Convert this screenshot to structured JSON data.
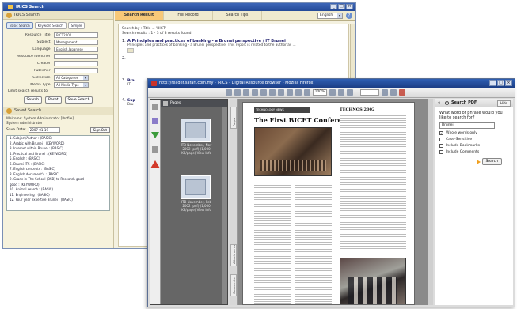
{
  "search_window": {
    "title": "IRICS Search",
    "window_controls": [
      "_",
      "□",
      "×"
    ],
    "basic_panel": {
      "heading": "IRICS Search",
      "modes": [
        "Basic Search",
        "Keyword Search",
        "Simple"
      ],
      "fields": [
        {
          "label": "Resource Title:",
          "value": "BICT2002",
          "kind": "input"
        },
        {
          "label": "Subject:",
          "value": "Management",
          "kind": "input"
        },
        {
          "label": "Language:",
          "value": "English,Japanese",
          "kind": "input"
        },
        {
          "label": "Resource Identifier:",
          "value": "",
          "kind": "input"
        },
        {
          "label": "Creator:",
          "value": "",
          "kind": "input"
        },
        {
          "label": "Publisher:",
          "value": "",
          "kind": "input"
        },
        {
          "label": "Collection:",
          "value": "All Categories",
          "kind": "select"
        },
        {
          "label": "Media Type:",
          "value": "All Media Type",
          "kind": "select"
        }
      ],
      "limit_label": "Limit search results to:",
      "actions": [
        "Search",
        "Reset",
        "Save Search"
      ]
    },
    "saved_panel": {
      "heading": "Saved Search",
      "info_lines": [
        "Welcome: System Administrator [Profile]",
        "System Administrator"
      ],
      "date_label": "Save Date:",
      "date_value": "2007-01-19",
      "sign_out": "Sign Out",
      "items": [
        "1. Subject/Author : (BASIC)",
        "2. Arabic with Brunei : (KEYWORD)",
        "3. Internet within Brunei : (BASIC)",
        "4. Practical and Brunei : (KEYWORD)",
        "5. English : (BASIC)",
        "6. Brunei ITS : (BASIC)",
        "7. English concepts : (BASIC)",
        "8. English document's : (BASIC)",
        "9. Grade in The School (BSB) to Research good",
        "   good : (KEYWORD)",
        "10. Animal search : (BASIC)",
        "11. Engineering : (BASIC)",
        "12. Four year expertise Brunei : (BASIC)"
      ]
    },
    "tabs": [
      "Search Result",
      "Full Record",
      "Search Tips"
    ],
    "active_tab": "Search Result",
    "language": "English",
    "results_header": "Search by : Title = 'BICT'",
    "results_count": "Search results : 1 - 3 of 3 results found",
    "results": [
      {
        "num": "1.",
        "title": "A Principles and practices of banking - a Brunei perspective / IT Brunei",
        "sub": "Principles and practices of banking - a Brunei perspective. This report is related to the author as ..."
      },
      {
        "num": "2.",
        "title": "",
        "sub": ""
      },
      {
        "num": "3.",
        "title": "Bra",
        "sub": "IT"
      },
      {
        "num": "4.",
        "title": "Sup",
        "sub": "Bru"
      }
    ]
  },
  "pdf_window": {
    "title": "http://reader.safari.com.my - IRICS - Digital Resource Browser - Mozilla Firefox",
    "window_controls": [
      "_",
      "□",
      "×"
    ],
    "zoom": "100%",
    "pages_panel": {
      "heading": "Pages",
      "thumbs": [
        {
          "caption": "ITB November, Nov 2002 (pdf) (1,000 KB/page) View Info"
        },
        {
          "caption": "ITB November, Feb 2002 (pdf) (1,000 KB/page) View Info"
        }
      ]
    },
    "side_tabs": [
      "Pages",
      "Attachments",
      "Comments"
    ],
    "document": {
      "masthead": "TECHNOLOGY NEWS",
      "title": "The First BICET Conference",
      "side_heading": "TECHNOS 2002"
    },
    "search_pane": {
      "heading": "Search PDF",
      "hide": "Hide",
      "question": "What word or phrase would you like to search for?",
      "query": "Brunei",
      "options": [
        {
          "label": "Whole words only",
          "checked": true
        },
        {
          "label": "Case-Sensitive",
          "checked": false
        },
        {
          "label": "Include Bookmarks",
          "checked": false
        },
        {
          "label": "Include Comments",
          "checked": false
        }
      ],
      "search_button": "Search"
    }
  }
}
